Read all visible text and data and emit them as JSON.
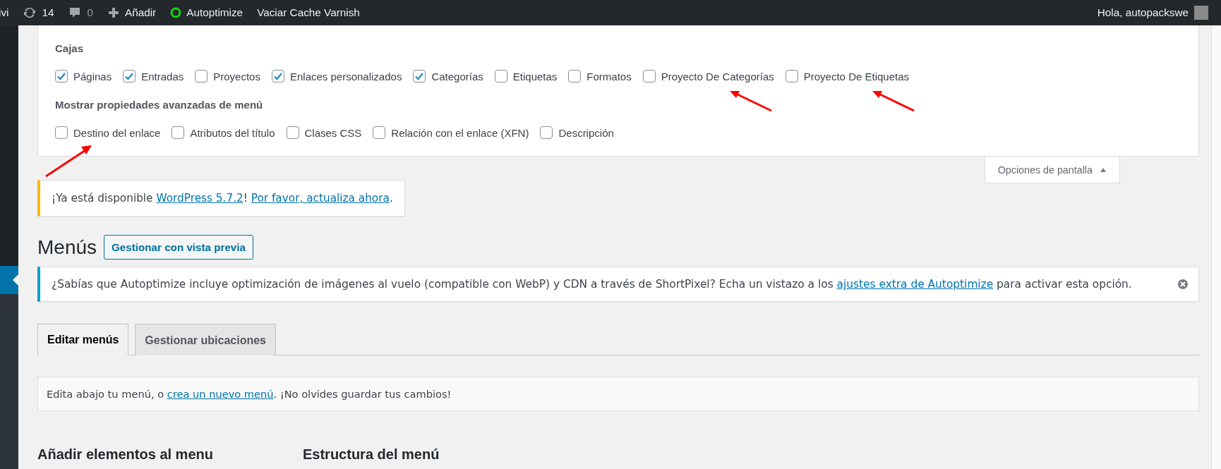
{
  "admin_bar": {
    "items": [
      {
        "kind": "text",
        "label": "ivi"
      },
      {
        "kind": "updates",
        "label": "14"
      },
      {
        "kind": "comments",
        "label": "0"
      },
      {
        "kind": "new",
        "label": "Añadir"
      },
      {
        "kind": "status",
        "label": "Autoptimize"
      },
      {
        "kind": "text",
        "label": "Vaciar Cache Varnish"
      }
    ],
    "greeting": "Hola, autopackswe"
  },
  "screen_options": {
    "sections": [
      {
        "title": "Cajas",
        "options": [
          {
            "label": "Páginas",
            "checked": true
          },
          {
            "label": "Entradas",
            "checked": true
          },
          {
            "label": "Proyectos",
            "checked": false
          },
          {
            "label": "Enlaces personalizados",
            "checked": true
          },
          {
            "label": "Categorías",
            "checked": true
          },
          {
            "label": "Etiquetas",
            "checked": false
          },
          {
            "label": "Formatos",
            "checked": false
          },
          {
            "label": "Proyecto De Categorías",
            "checked": false,
            "arrowed": true
          },
          {
            "label": "Proyecto De Etiquetas",
            "checked": false,
            "arrowed": true
          }
        ]
      },
      {
        "title": "Mostrar propiedades avanzadas de menú",
        "options": [
          {
            "label": "Destino del enlace",
            "checked": false,
            "arrowed": true
          },
          {
            "label": "Atributos del título",
            "checked": false
          },
          {
            "label": "Clases CSS",
            "checked": false
          },
          {
            "label": "Relación con el enlace (XFN)",
            "checked": false
          },
          {
            "label": "Descripción",
            "checked": false
          }
        ]
      }
    ],
    "toggle": {
      "label": "Opciones de pantalla",
      "expanded": true
    }
  },
  "update_notice": {
    "parts": [
      {
        "text": "¡Ya está disponible "
      },
      {
        "text": "WordPress 5.7.2",
        "link": true
      },
      {
        "text": "! "
      },
      {
        "text": "Por favor, actualiza ahora",
        "link": true
      },
      {
        "text": "."
      }
    ]
  },
  "page_title": "Menús",
  "preview_button": "Gestionar con vista previa",
  "info_notice": {
    "dismissible": true,
    "parts": [
      {
        "text": "¿Sabías que Autoptimize incluye optimización de imágenes al vuelo (compatible con WebP) y CDN a través de ShortPixel? Echa un vistazo a los "
      },
      {
        "text": "ajustes extra de Autoptimize",
        "link": true
      },
      {
        "text": " para activar esta opción."
      }
    ]
  },
  "tabs": [
    {
      "label": "Editar menús",
      "selected": true
    },
    {
      "label": "Gestionar ubicaciones",
      "selected": false
    }
  ],
  "menu_info": {
    "parts": [
      {
        "text": "Edita abajo tu menú, o "
      },
      {
        "text": "crea un nuevo menú",
        "link": true
      },
      {
        "text": ". ¡No olvides guardar tus cambios!"
      }
    ]
  },
  "columns": [
    "Añadir elementos al menu",
    "Estructura del menú"
  ]
}
